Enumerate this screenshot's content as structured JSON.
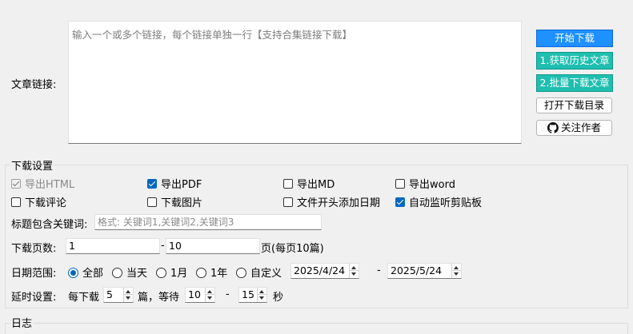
{
  "link": {
    "label": "文章链接:",
    "placeholder": "输入一个或多个链接，每个链接单独一行【支持合集链接下载】"
  },
  "buttons": {
    "start": "开始下载",
    "history": "1.获取历史文章",
    "batch": "2.批量下载文章",
    "open_dir": "打开下载目录",
    "follow": "关注作者"
  },
  "settings": {
    "title": "下载设置",
    "checkboxes": [
      {
        "label": "导出HTML",
        "checked": true,
        "disabled": true
      },
      {
        "label": "导出PDF",
        "checked": true,
        "disabled": false
      },
      {
        "label": "导出MD",
        "checked": false,
        "disabled": false
      },
      {
        "label": "导出word",
        "checked": false,
        "disabled": false
      },
      {
        "label": "下载评论",
        "checked": false,
        "disabled": false
      },
      {
        "label": "下载图片",
        "checked": false,
        "disabled": false
      },
      {
        "label": "文件开头添加日期",
        "checked": false,
        "disabled": false
      },
      {
        "label": "自动监听剪贴板",
        "checked": true,
        "disabled": false
      }
    ],
    "keyword": {
      "label": "标题包含关键词:",
      "placeholder": "格式: 关键词1,关键词2,关键词3"
    },
    "pages": {
      "label": "下载页数:",
      "from": "1",
      "dash": "-",
      "to": "10",
      "suffix": "页(每页10篇)"
    },
    "date": {
      "label": "日期范围:",
      "options": [
        {
          "label": "全部",
          "selected": true
        },
        {
          "label": "当天",
          "selected": false
        },
        {
          "label": "1月",
          "selected": false
        },
        {
          "label": "1年",
          "selected": false
        },
        {
          "label": "自定义",
          "selected": false
        }
      ],
      "start": "2025/4/24",
      "dash": "-",
      "end": "2025/5/24"
    },
    "delay": {
      "label": "延时设置:",
      "per_prefix": "每下载",
      "per_value": "5",
      "per_suffix": "篇，等待",
      "wait_min": "10",
      "dash": "-",
      "wait_max": "15",
      "unit": "秒"
    }
  },
  "log": {
    "title": "日志"
  }
}
